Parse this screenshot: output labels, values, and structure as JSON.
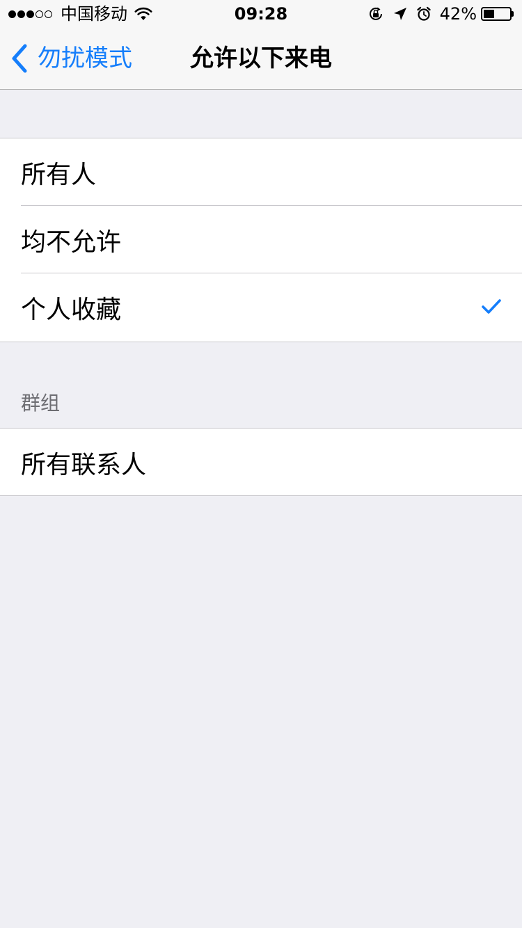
{
  "status_bar": {
    "signal_bars_on": 3,
    "signal_bars_total": 5,
    "carrier": "中国移动",
    "time": "09:28",
    "battery_percent": "42%",
    "battery_level": 0.42,
    "icons": [
      "wifi-icon",
      "rotation-lock-icon",
      "location-arrow-icon",
      "alarm-icon",
      "battery-icon"
    ]
  },
  "nav": {
    "back_label": "勿扰模式",
    "title": "允许以下来电"
  },
  "options": [
    {
      "label": "所有人",
      "selected": false
    },
    {
      "label": "均不允许",
      "selected": false
    },
    {
      "label": "个人收藏",
      "selected": true
    }
  ],
  "groups_section": {
    "header": "群组",
    "items": [
      {
        "label": "所有联系人"
      }
    ]
  },
  "colors": {
    "accent": "#157efb",
    "background": "#efeff4",
    "separator": "#c8c7cc",
    "section_header": "#6d6d72"
  }
}
